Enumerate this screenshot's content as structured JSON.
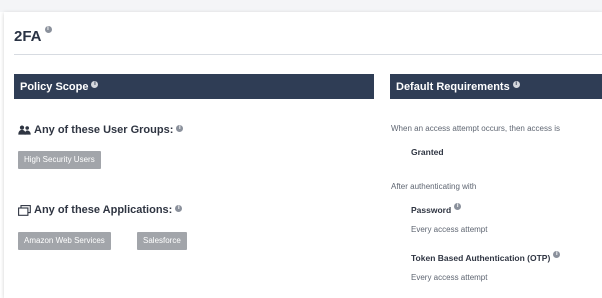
{
  "page": {
    "title": "2FA",
    "info_icon": "info-icon"
  },
  "policy_scope": {
    "header": "Policy Scope",
    "user_groups_label": "Any of these User Groups:",
    "user_groups": [
      "High Security Users"
    ],
    "applications_label": "Any of these Applications:",
    "applications": [
      "Amazon Web Services",
      "Salesforce"
    ]
  },
  "default_requirements": {
    "header": "Default Requirements",
    "access_intro": "When an access attempt occurs, then access is",
    "access_result": "Granted",
    "after_auth_label": "After authenticating with",
    "requirements": [
      {
        "name": "Password",
        "frequency": "Every access attempt"
      },
      {
        "name": "Token Based Authentication (OTP)",
        "frequency": "Every access attempt"
      }
    ]
  },
  "colors": {
    "section_header_bg": "#2f3d55",
    "chip_bg": "#a2a5aa",
    "title_text": "#2a3344"
  }
}
